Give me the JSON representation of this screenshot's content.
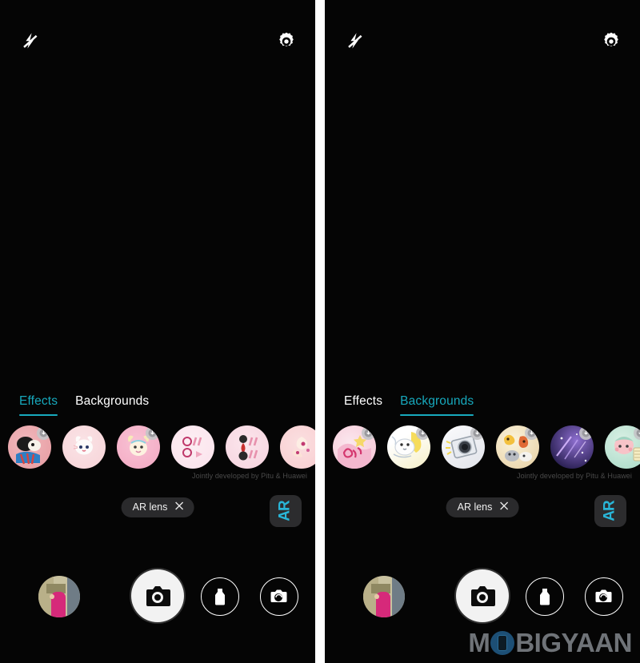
{
  "accent_color": "#17a9bd",
  "background_color": "#050505",
  "watermark": {
    "text_before": "M",
    "text_after": "BIGYAAN"
  },
  "panels": [
    {
      "id": "left",
      "topbar": {
        "flash_icon": "flash-off-icon",
        "settings_icon": "gear-icon"
      },
      "tabs": [
        {
          "label": "Effects",
          "active": true
        },
        {
          "label": "Backgrounds",
          "active": false
        }
      ],
      "thumbnails": [
        {
          "name": "effect-thumb-1",
          "badge": true,
          "colors": [
            "#e79ba0",
            "#f0b8bd"
          ]
        },
        {
          "name": "effect-thumb-2",
          "badge": false,
          "colors": [
            "#f7d3d7",
            "#fae3e6"
          ]
        },
        {
          "name": "effect-thumb-3",
          "badge": true,
          "colors": [
            "#f3a8c2",
            "#f8c2d4"
          ]
        },
        {
          "name": "effect-thumb-4",
          "badge": false,
          "colors": [
            "#fae2ec",
            "#fdeef3"
          ]
        },
        {
          "name": "effect-thumb-5",
          "badge": false,
          "colors": [
            "#fbe5ec",
            "#f6d3de"
          ]
        },
        {
          "name": "effect-thumb-6",
          "badge": false,
          "colors": [
            "#f8cdd0",
            "#fbdfe0"
          ]
        },
        {
          "name": "effect-thumb-7",
          "badge": false,
          "colors": [
            "#f2b4bb",
            "#f6ccd1"
          ]
        }
      ],
      "attribution": "Jointly developed by Pitu & Huawei",
      "ar_lens_chip": {
        "label": "AR lens",
        "close_icon": "close-icon"
      },
      "ar_button_label": "AR",
      "controls": {
        "gallery": "gallery-thumbnail",
        "shutter": "shutter-button",
        "filter": "filter-button",
        "flip": "camera-switch-button"
      }
    },
    {
      "id": "right",
      "topbar": {
        "flash_icon": "flash-off-icon",
        "settings_icon": "gear-icon"
      },
      "tabs": [
        {
          "label": "Effects",
          "active": false
        },
        {
          "label": "Backgrounds",
          "active": true
        }
      ],
      "thumbnails": [
        {
          "name": "background-thumb-1",
          "badge": true,
          "colors": [
            "#f6c5d4",
            "#fbe7ee"
          ]
        },
        {
          "name": "background-thumb-2",
          "badge": true,
          "colors": [
            "#eef2f6",
            "#f8f3cf"
          ]
        },
        {
          "name": "background-thumb-3",
          "badge": true,
          "colors": [
            "#f3f1f4",
            "#dcdde2"
          ]
        },
        {
          "name": "background-thumb-4",
          "badge": true,
          "colors": [
            "#f4e9c9",
            "#e9c79a"
          ]
        },
        {
          "name": "background-thumb-5",
          "badge": true,
          "colors": [
            "#6c4fb0",
            "#352a63"
          ]
        },
        {
          "name": "background-thumb-6",
          "badge": true,
          "colors": [
            "#bfe3d6",
            "#f2cfd1"
          ]
        },
        {
          "name": "background-thumb-7",
          "badge": false,
          "colors": [
            "#2a3f8f",
            "#1b2a63"
          ]
        }
      ],
      "attribution": "Jointly developed by Pitu & Huawei",
      "ar_lens_chip": {
        "label": "AR lens",
        "close_icon": "close-icon"
      },
      "ar_button_label": "AR",
      "controls": {
        "gallery": "gallery-thumbnail",
        "shutter": "shutter-button",
        "filter": "filter-button",
        "flip": "camera-switch-button"
      }
    }
  ]
}
